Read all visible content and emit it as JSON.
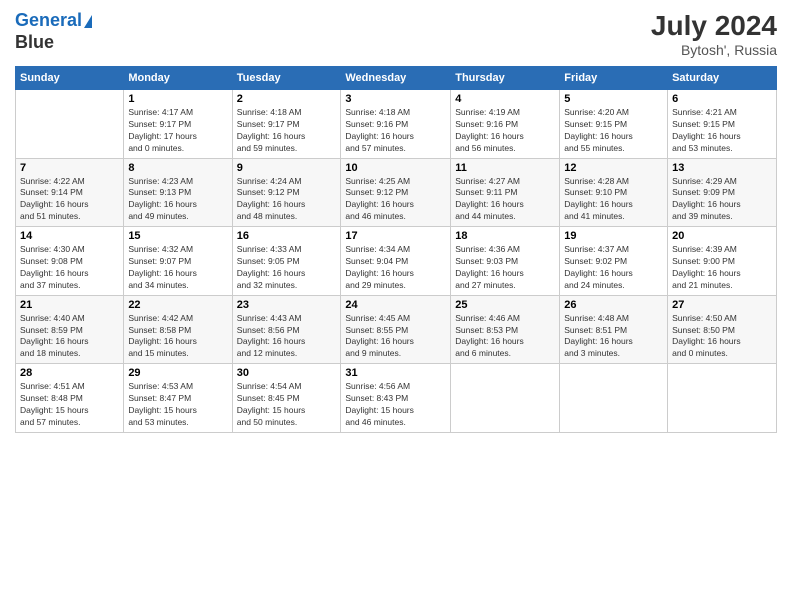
{
  "header": {
    "logo_line1": "General",
    "logo_line2": "Blue",
    "month_year": "July 2024",
    "location": "Bytosh', Russia"
  },
  "weekdays": [
    "Sunday",
    "Monday",
    "Tuesday",
    "Wednesday",
    "Thursday",
    "Friday",
    "Saturday"
  ],
  "weeks": [
    [
      {
        "day": "",
        "info": ""
      },
      {
        "day": "1",
        "info": "Sunrise: 4:17 AM\nSunset: 9:17 PM\nDaylight: 17 hours\nand 0 minutes."
      },
      {
        "day": "2",
        "info": "Sunrise: 4:18 AM\nSunset: 9:17 PM\nDaylight: 16 hours\nand 59 minutes."
      },
      {
        "day": "3",
        "info": "Sunrise: 4:18 AM\nSunset: 9:16 PM\nDaylight: 16 hours\nand 57 minutes."
      },
      {
        "day": "4",
        "info": "Sunrise: 4:19 AM\nSunset: 9:16 PM\nDaylight: 16 hours\nand 56 minutes."
      },
      {
        "day": "5",
        "info": "Sunrise: 4:20 AM\nSunset: 9:15 PM\nDaylight: 16 hours\nand 55 minutes."
      },
      {
        "day": "6",
        "info": "Sunrise: 4:21 AM\nSunset: 9:15 PM\nDaylight: 16 hours\nand 53 minutes."
      }
    ],
    [
      {
        "day": "7",
        "info": "Sunrise: 4:22 AM\nSunset: 9:14 PM\nDaylight: 16 hours\nand 51 minutes."
      },
      {
        "day": "8",
        "info": "Sunrise: 4:23 AM\nSunset: 9:13 PM\nDaylight: 16 hours\nand 49 minutes."
      },
      {
        "day": "9",
        "info": "Sunrise: 4:24 AM\nSunset: 9:12 PM\nDaylight: 16 hours\nand 48 minutes."
      },
      {
        "day": "10",
        "info": "Sunrise: 4:25 AM\nSunset: 9:12 PM\nDaylight: 16 hours\nand 46 minutes."
      },
      {
        "day": "11",
        "info": "Sunrise: 4:27 AM\nSunset: 9:11 PM\nDaylight: 16 hours\nand 44 minutes."
      },
      {
        "day": "12",
        "info": "Sunrise: 4:28 AM\nSunset: 9:10 PM\nDaylight: 16 hours\nand 41 minutes."
      },
      {
        "day": "13",
        "info": "Sunrise: 4:29 AM\nSunset: 9:09 PM\nDaylight: 16 hours\nand 39 minutes."
      }
    ],
    [
      {
        "day": "14",
        "info": "Sunrise: 4:30 AM\nSunset: 9:08 PM\nDaylight: 16 hours\nand 37 minutes."
      },
      {
        "day": "15",
        "info": "Sunrise: 4:32 AM\nSunset: 9:07 PM\nDaylight: 16 hours\nand 34 minutes."
      },
      {
        "day": "16",
        "info": "Sunrise: 4:33 AM\nSunset: 9:05 PM\nDaylight: 16 hours\nand 32 minutes."
      },
      {
        "day": "17",
        "info": "Sunrise: 4:34 AM\nSunset: 9:04 PM\nDaylight: 16 hours\nand 29 minutes."
      },
      {
        "day": "18",
        "info": "Sunrise: 4:36 AM\nSunset: 9:03 PM\nDaylight: 16 hours\nand 27 minutes."
      },
      {
        "day": "19",
        "info": "Sunrise: 4:37 AM\nSunset: 9:02 PM\nDaylight: 16 hours\nand 24 minutes."
      },
      {
        "day": "20",
        "info": "Sunrise: 4:39 AM\nSunset: 9:00 PM\nDaylight: 16 hours\nand 21 minutes."
      }
    ],
    [
      {
        "day": "21",
        "info": "Sunrise: 4:40 AM\nSunset: 8:59 PM\nDaylight: 16 hours\nand 18 minutes."
      },
      {
        "day": "22",
        "info": "Sunrise: 4:42 AM\nSunset: 8:58 PM\nDaylight: 16 hours\nand 15 minutes."
      },
      {
        "day": "23",
        "info": "Sunrise: 4:43 AM\nSunset: 8:56 PM\nDaylight: 16 hours\nand 12 minutes."
      },
      {
        "day": "24",
        "info": "Sunrise: 4:45 AM\nSunset: 8:55 PM\nDaylight: 16 hours\nand 9 minutes."
      },
      {
        "day": "25",
        "info": "Sunrise: 4:46 AM\nSunset: 8:53 PM\nDaylight: 16 hours\nand 6 minutes."
      },
      {
        "day": "26",
        "info": "Sunrise: 4:48 AM\nSunset: 8:51 PM\nDaylight: 16 hours\nand 3 minutes."
      },
      {
        "day": "27",
        "info": "Sunrise: 4:50 AM\nSunset: 8:50 PM\nDaylight: 16 hours\nand 0 minutes."
      }
    ],
    [
      {
        "day": "28",
        "info": "Sunrise: 4:51 AM\nSunset: 8:48 PM\nDaylight: 15 hours\nand 57 minutes."
      },
      {
        "day": "29",
        "info": "Sunrise: 4:53 AM\nSunset: 8:47 PM\nDaylight: 15 hours\nand 53 minutes."
      },
      {
        "day": "30",
        "info": "Sunrise: 4:54 AM\nSunset: 8:45 PM\nDaylight: 15 hours\nand 50 minutes."
      },
      {
        "day": "31",
        "info": "Sunrise: 4:56 AM\nSunset: 8:43 PM\nDaylight: 15 hours\nand 46 minutes."
      },
      {
        "day": "",
        "info": ""
      },
      {
        "day": "",
        "info": ""
      },
      {
        "day": "",
        "info": ""
      }
    ]
  ]
}
